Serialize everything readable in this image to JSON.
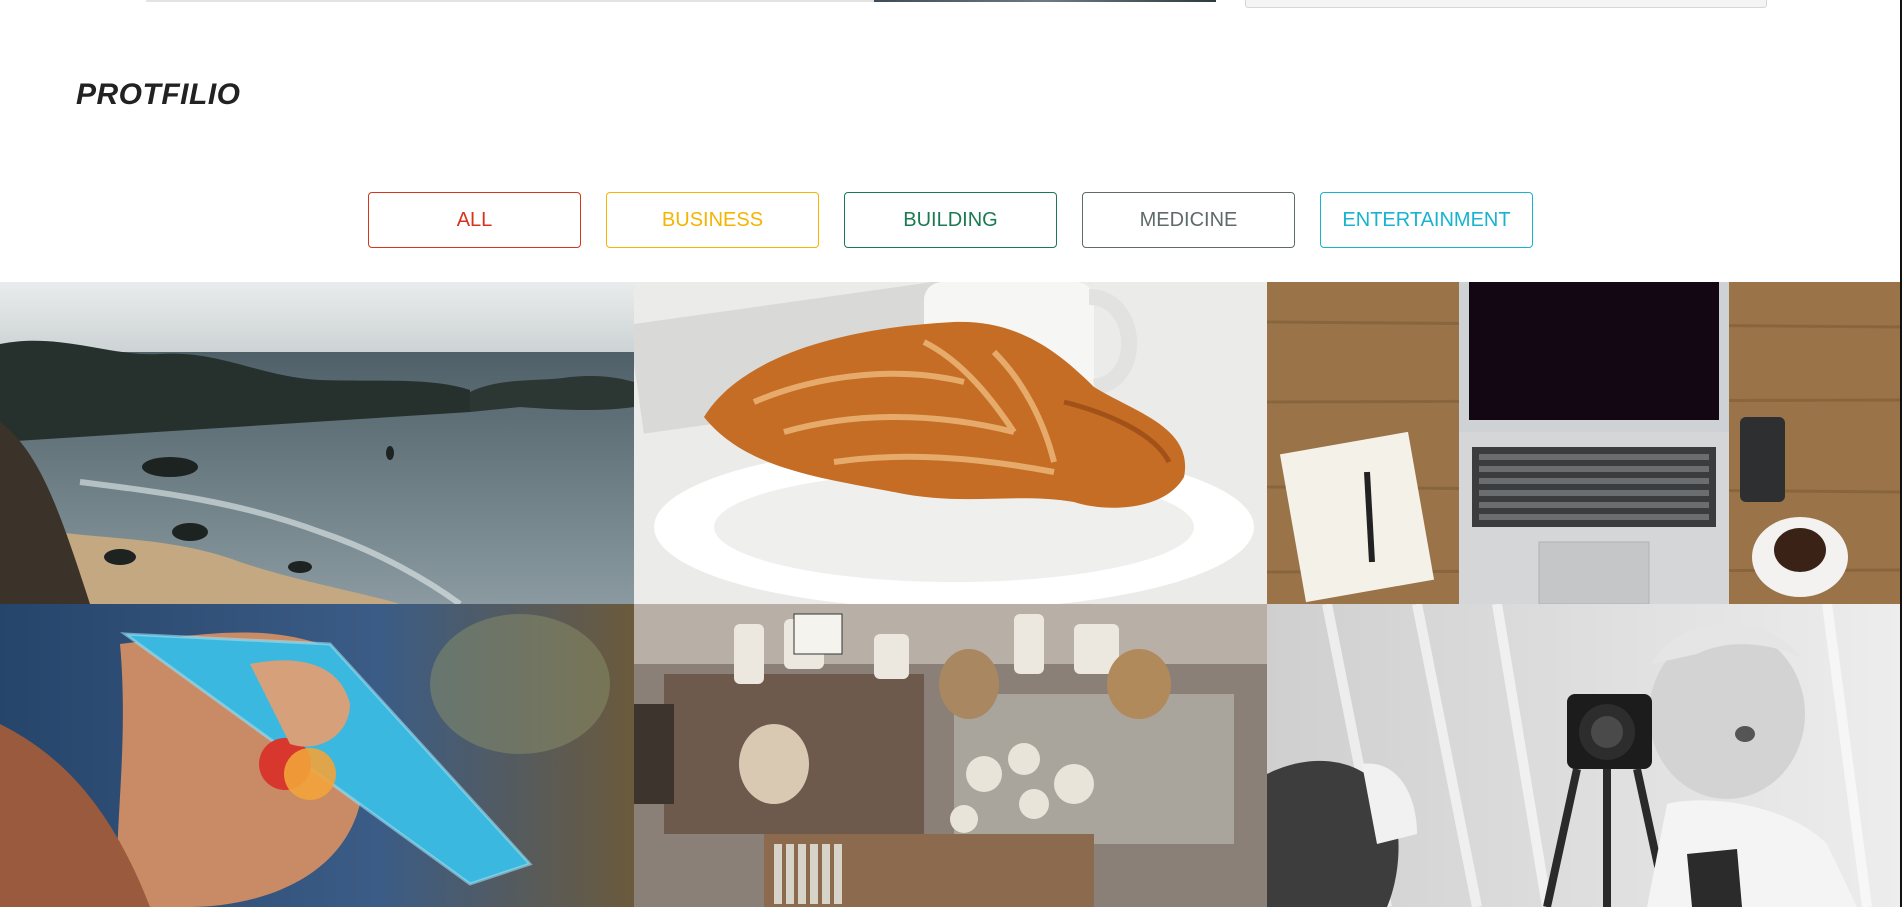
{
  "section": {
    "title": "PROTFILIO"
  },
  "filters": [
    {
      "label": "ALL",
      "color": "#d4351c"
    },
    {
      "label": "BUSINESS",
      "color": "#f4b400"
    },
    {
      "label": "BUILDING",
      "color": "#1b7a52"
    },
    {
      "label": "MEDICINE",
      "color": "#5f6b6a"
    },
    {
      "label": "ENTERTAINMENT",
      "color": "#18b3d1"
    }
  ],
  "gallery": {
    "images": [
      "beach-coastline-photo",
      "croissant-on-plate-photo",
      "laptop-notebook-coffee-photo",
      "credit-card-in-hand-photo",
      "antique-market-stall-photo",
      "child-with-camera-photo"
    ]
  }
}
